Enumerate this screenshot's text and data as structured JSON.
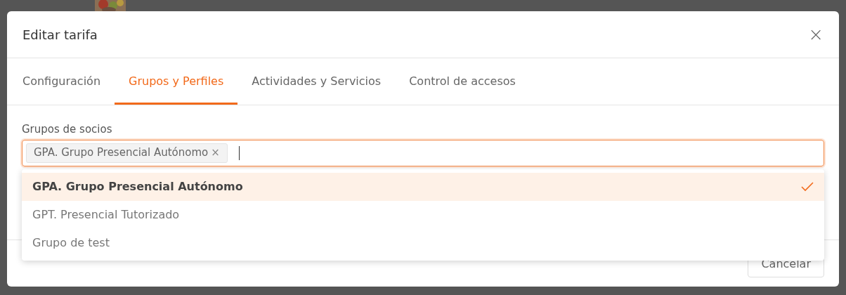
{
  "dialog": {
    "title": "Editar tarifa",
    "close": "×"
  },
  "tabs": [
    {
      "label": "Configuración",
      "selected": false
    },
    {
      "label": "Grupos y Perfiles",
      "selected": true
    },
    {
      "label": "Actividades y Servicios",
      "selected": false
    },
    {
      "label": "Control de accesos",
      "selected": false
    }
  ],
  "field": {
    "label": "Grupos de socios",
    "tags": [
      {
        "label": "GPA. Grupo Presencial Autónomo",
        "remove": "×"
      }
    ]
  },
  "dropdown": {
    "options": [
      {
        "label": "GPA. Grupo Presencial Autónomo",
        "selected": true
      },
      {
        "label": "GPT. Presencial Tutorizado",
        "selected": false
      },
      {
        "label": "Grupo de test",
        "selected": false
      }
    ]
  },
  "footer": {
    "buttons": [
      "Cancelar"
    ]
  }
}
